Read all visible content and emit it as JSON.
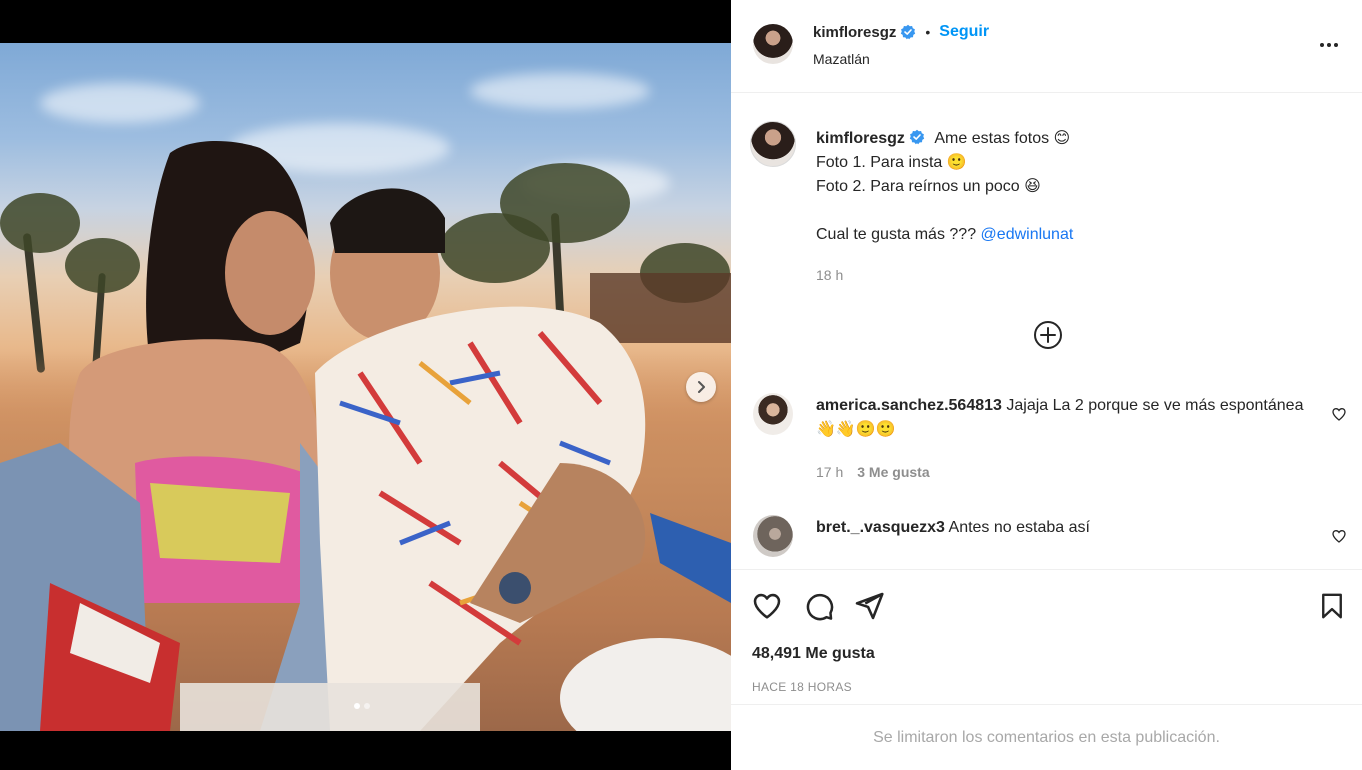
{
  "post": {
    "username": "kimfloresgz",
    "follow_label": "Seguir",
    "separator": "•",
    "location": "Mazatlán"
  },
  "caption": {
    "username": "kimfloresgz",
    "lines": [
      "Ame estas fotos 😊",
      "Foto 1. Para insta 🙂",
      "Foto 2. Para reírnos un poco 😆",
      "",
      "Cual te gusta más ???"
    ],
    "mention": "@edwinlunat",
    "time": "18 h"
  },
  "comments": [
    {
      "username": "america.sanchez.564813",
      "text": "Jajaja La 2 porque se ve más espontánea 👋👋🙂🙂",
      "time": "17 h",
      "likes": "3 Me gusta"
    },
    {
      "username": "bret._.vasquezx3",
      "text": "Antes no estaba así"
    }
  ],
  "stats": {
    "likes": "48,491 Me gusta",
    "time_ago": "HACE 18 HORAS"
  },
  "footer": {
    "limited_comments": "Se limitaron los comentarios en esta publicación."
  },
  "icons": {
    "verified": "verified-badge-icon",
    "more": "more-options-icon",
    "add_comment": "plus-circle-icon",
    "like": "heart-icon",
    "comment": "comment-bubble-icon",
    "share": "paper-plane-icon",
    "save": "bookmark-icon",
    "next": "chevron-right-icon"
  },
  "colors": {
    "accent": "#0095f6",
    "verified": "#3897f0",
    "text": "#262626",
    "muted": "#8e8e8e"
  },
  "carousel": {
    "slides": 2,
    "current": 1
  }
}
